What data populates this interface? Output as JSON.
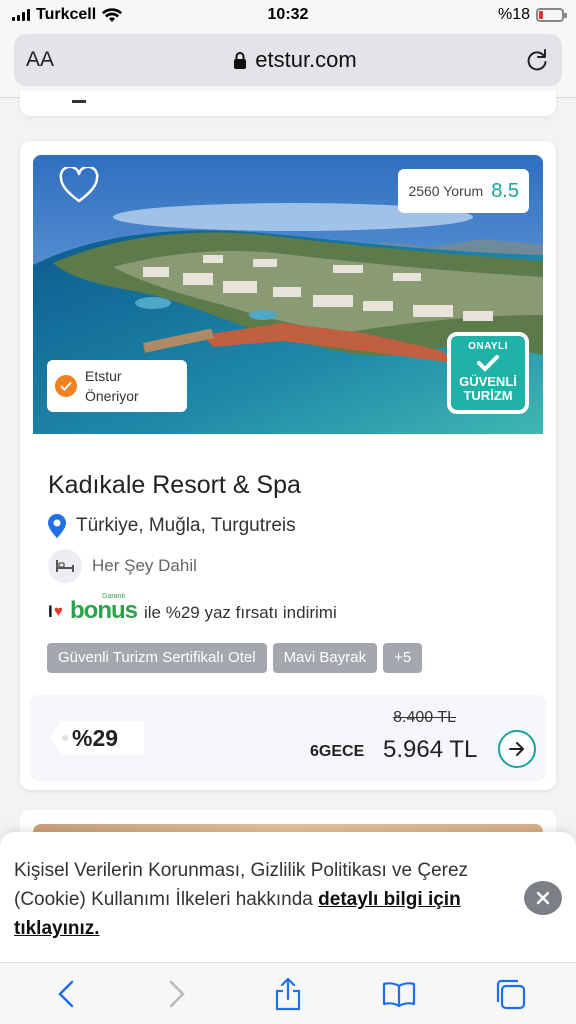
{
  "status_bar": {
    "carrier": "Turkcell",
    "time": "10:32",
    "battery": "%18"
  },
  "browser": {
    "text_size_label": "AA",
    "domain": "etstur.com"
  },
  "hotel": {
    "review_count": "2560 Yorum",
    "score": "8.5",
    "recommend_line1": "Etstur",
    "recommend_line2": "Öneriyor",
    "badge": {
      "line1": "ONAYLI",
      "line2": "GÜVENLİ",
      "line3": "TURİZM"
    },
    "name": "Kadıkale Resort & Spa",
    "location": "Türkiye,  Muğla,  Turgutreis",
    "board": "Her Şey Dahil",
    "bonus_text": "ile %29 yaz fırsatı indirimi",
    "tags": [
      "Güvenli Turizm Sertifikalı Otel",
      "Mavi Bayrak",
      "+5"
    ],
    "discount": "%29",
    "old_price": "8.400 TL",
    "nights": "6GECE",
    "price": "5.964 TL"
  },
  "consent": {
    "text": "Kişisel Verilerin Korunması, Gizlilik Politikası ve Çerez (Cookie) Kullanımı İlkeleri hakkında ",
    "link": "detaylı bilgi için tıklayınız."
  },
  "bonus_logo": {
    "i": "I",
    "word": "bonus",
    "small": "Garanti"
  },
  "colors": {
    "accent": "#1aa39c",
    "recommend": "#f2821f",
    "tag_bg": "#a4a7ad"
  }
}
